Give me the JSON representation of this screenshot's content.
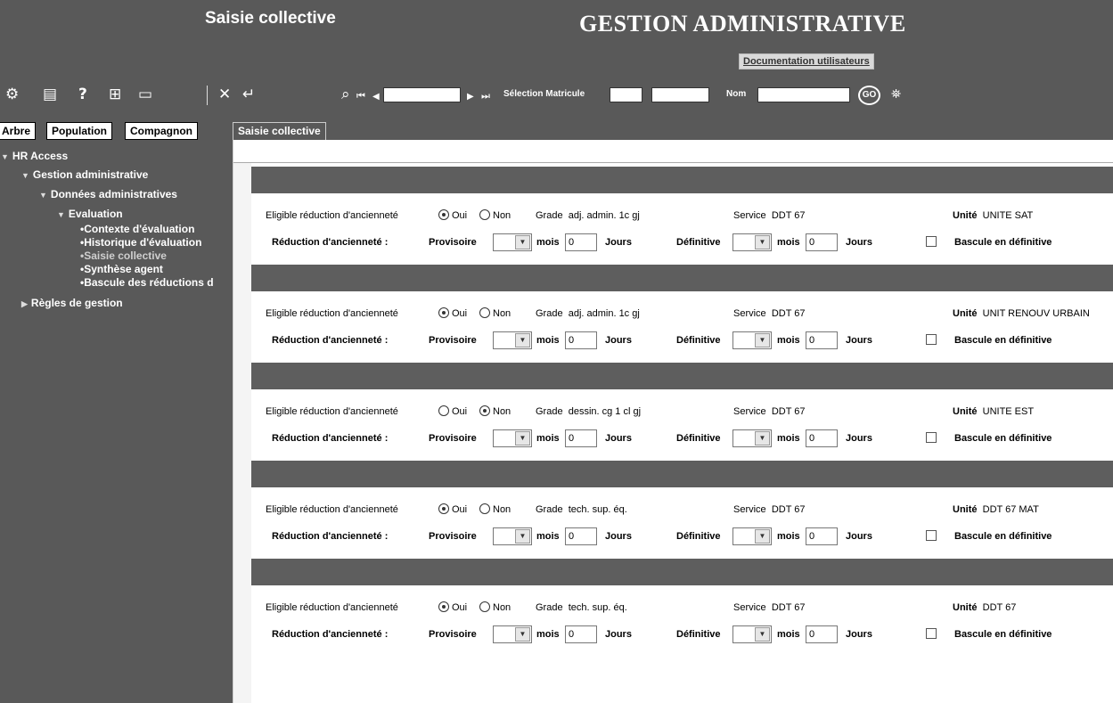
{
  "header": {
    "screen_title": "Saisie collective",
    "app_title": "GESTION ADMINISTRATIVE",
    "doc_link": "Documentation utilisateurs"
  },
  "toolbar": {
    "matricule_label": "Sélection Matricule",
    "nom_label": "Nom",
    "go_label": "GO"
  },
  "left_tabs": [
    "Arbre",
    "Population",
    "Compagnon"
  ],
  "main_tab": "Saisie collective",
  "tree": {
    "root": "HR Access",
    "gestion": "Gestion administrative",
    "donnees": "Données administratives",
    "evaluation": "Evaluation",
    "items": [
      "•Contexte d'évaluation",
      "•Historique d'évaluation",
      "•Saisie collective",
      "•Synthèse agent",
      "•Bascule des réductions d"
    ],
    "regles": "Règles de gestion"
  },
  "labels": {
    "eligible": "Eligible réduction d'ancienneté",
    "oui": "Oui",
    "non": "Non",
    "grade": "Grade",
    "service": "Service",
    "unite": "Unité",
    "reduction": "Réduction d'ancienneté :",
    "provisoire": "Provisoire",
    "mois": "mois",
    "jours": "Jours",
    "definitive": "Définitive",
    "bascule": "Bascule en définitive"
  },
  "rows": [
    {
      "eligible": "Oui",
      "grade": "adj. admin. 1c gj",
      "service": "DDT 67",
      "unite": "UNITE SAT",
      "mois_prov": "0",
      "mois_def": "0"
    },
    {
      "eligible": "Oui",
      "grade": "adj. admin. 1c gj",
      "service": "DDT 67",
      "unite": "UNIT RENOUV URBAIN",
      "mois_prov": "0",
      "mois_def": "0"
    },
    {
      "eligible": "Non",
      "grade": "dessin. cg 1 cl gj",
      "service": "DDT 67",
      "unite": "UNITE EST",
      "mois_prov": "0",
      "mois_def": "0"
    },
    {
      "eligible": "Oui",
      "grade": "tech. sup. éq.",
      "service": "DDT 67",
      "unite": "DDT 67 MAT",
      "mois_prov": "0",
      "mois_def": "0"
    },
    {
      "eligible": "Oui",
      "grade": "tech. sup. éq.",
      "service": "DDT 67",
      "unite": "DDT 67",
      "mois_prov": "0",
      "mois_def": "0"
    }
  ]
}
